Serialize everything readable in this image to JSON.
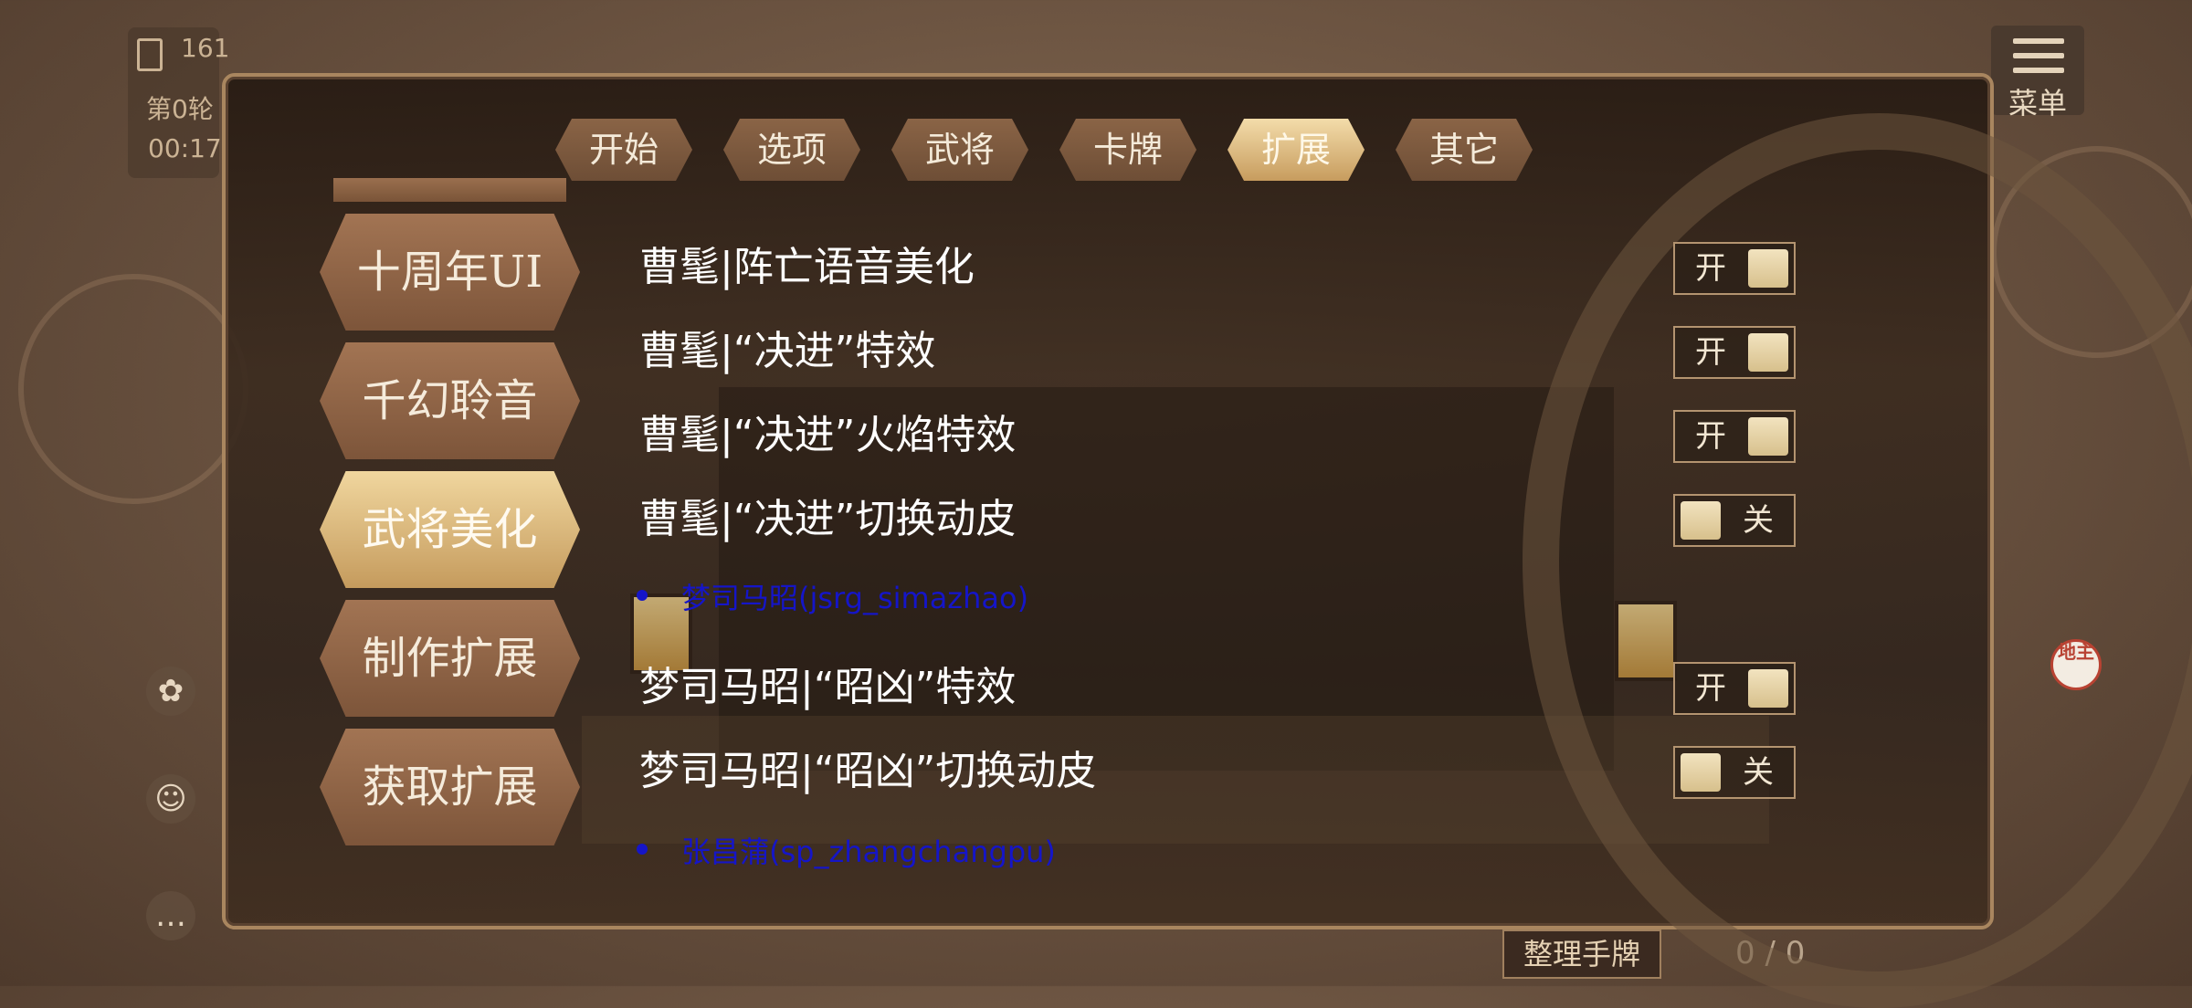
{
  "hud": {
    "card_count": "161",
    "round": "第0轮",
    "time": "00:17"
  },
  "menu": {
    "label": "菜单"
  },
  "dealer_badge": "地主",
  "bottom": {
    "organize_label": "整理手牌",
    "hand_count": "0 / 0"
  },
  "top_tabs": [
    {
      "label": "开始",
      "active": false
    },
    {
      "label": "选项",
      "active": false
    },
    {
      "label": "武将",
      "active": false
    },
    {
      "label": "卡牌",
      "active": false
    },
    {
      "label": "扩展",
      "active": true
    },
    {
      "label": "其它",
      "active": false
    }
  ],
  "left_tabs": [
    {
      "label": "十周年UI",
      "active": false
    },
    {
      "label": "千幻聆音",
      "active": false
    },
    {
      "label": "武将美化",
      "active": true
    },
    {
      "label": "制作扩展",
      "active": false
    },
    {
      "label": "获取扩展",
      "active": false
    }
  ],
  "options": [
    {
      "label": "曹髦|阵亡语音美化",
      "state": "开"
    },
    {
      "label": "曹髦|“决进”特效",
      "state": "开"
    },
    {
      "label": "曹髦|“决进”火焰特效",
      "state": "开"
    },
    {
      "label": "曹髦|“决进”切换动皮",
      "state": "关"
    },
    {
      "label": "梦司马昭|“昭凶”特效",
      "state": "开"
    },
    {
      "label": "梦司马昭|“昭凶”切换动皮",
      "state": "关"
    }
  ],
  "links": [
    "梦司马昭(jsrg_simazhao)",
    "张昌蒲(sp_zhangchangpu)"
  ],
  "colors": {
    "link": "#1515c8",
    "active_tab": "#e9cc92",
    "tab": "#7d553a"
  }
}
